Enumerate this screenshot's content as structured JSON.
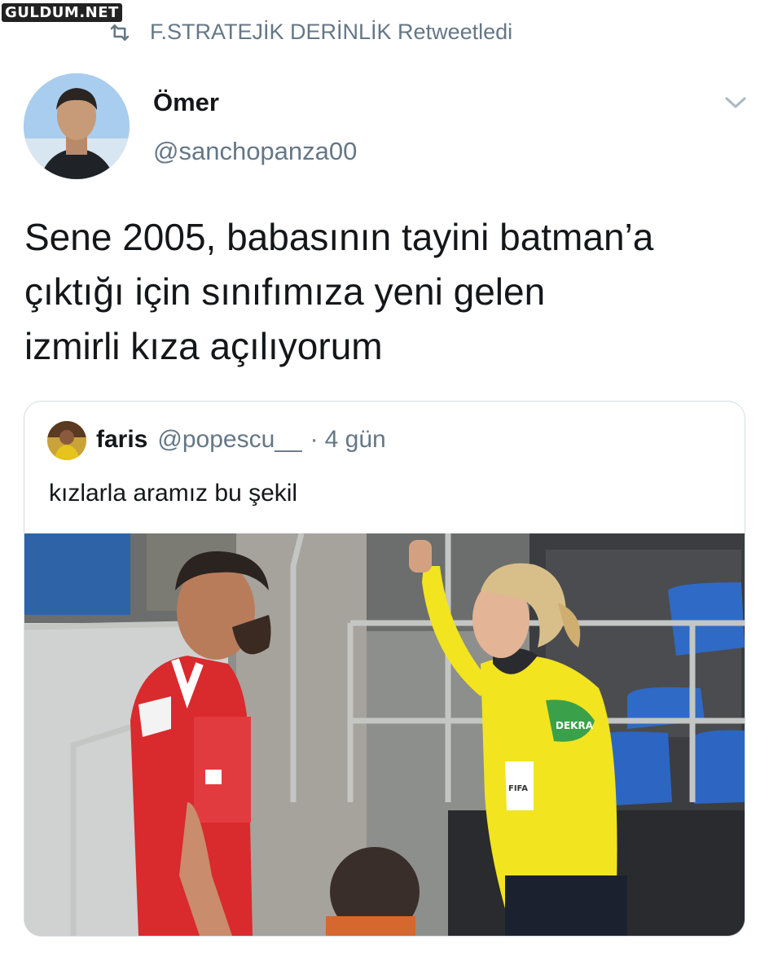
{
  "watermark": "GULDUM.NET",
  "retweet": {
    "text": "F.STRATEJİK DERİNLİK Retweetledi"
  },
  "author": {
    "name": "Ömer",
    "handle": "@sanchopanza00"
  },
  "tweet": {
    "text": "Sene 2005, babasının tayini batman’a\nçıktığı için sınıfımıza yeni gelen\nizmirli kıza açılıyorum"
  },
  "quote": {
    "name": "faris",
    "handle": "@popescu__",
    "separator": "·",
    "time": "4 gün",
    "text": "kızlarla aramız bu şekil",
    "photo": {
      "sleeve_badge": "DEKRA",
      "chest_badge": "FIFA"
    }
  },
  "colors": {
    "secondary_text": "#657786",
    "border": "#d6dde3",
    "referee_yellow": "#f2e41f",
    "player_red": "#d92a2e"
  }
}
